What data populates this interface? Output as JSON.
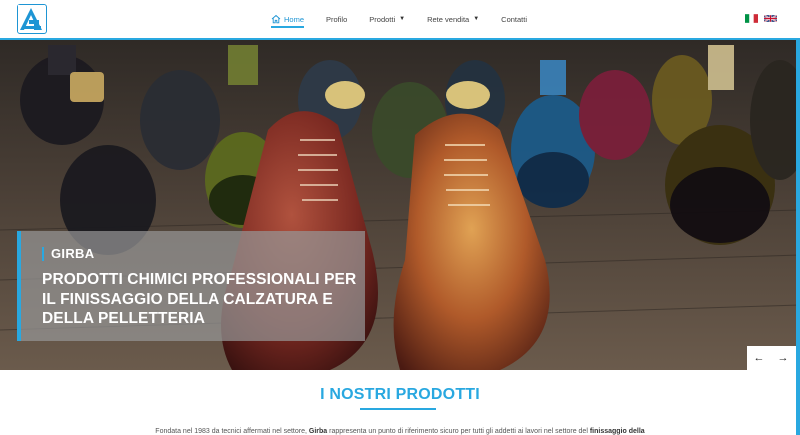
{
  "header": {
    "logo_alt": "Girba logo",
    "nav": [
      {
        "label": "Home",
        "icon": "home-icon",
        "active": true
      },
      {
        "label": "Profilo"
      },
      {
        "label": "Prodotti",
        "has_caret": true
      },
      {
        "label": "Rete vendita",
        "has_caret": true
      },
      {
        "label": "Contatti"
      }
    ],
    "caret": "▼",
    "flags": [
      "italian-flag",
      "uk-flag"
    ]
  },
  "hero": {
    "brand": "GIRBA",
    "title": "PRODOTTI CHIMICI PROFESSIONALI PER IL FINISSAGGIO DELLA CALZATURA E DELLA PELLETTERIA",
    "prev": "←",
    "next": "→"
  },
  "section": {
    "title": "I NOSTRI PRODOTTI",
    "intro_1": "Fondata nel 1983 da tecnici affermati nel settore, ",
    "intro_brand": "Girba",
    "intro_2": " rappresenta un punto di riferimento sicuro per tutti gli addetti ai lavori nel settore del ",
    "intro_bold": "finissaggio della"
  },
  "colors": {
    "accent": "#29a8e0",
    "hero_overlay": "rgba(150,150,150,0.72)"
  }
}
